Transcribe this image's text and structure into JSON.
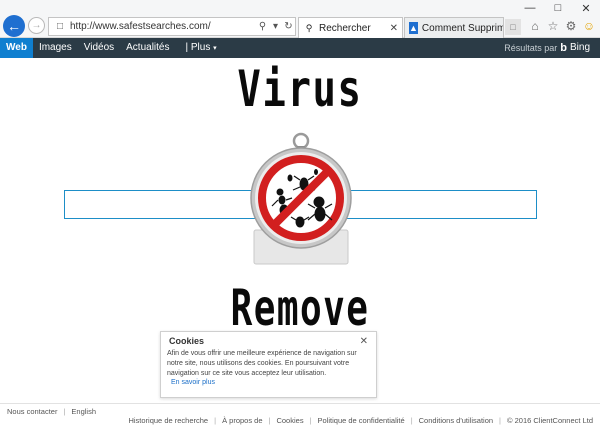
{
  "browser": {
    "address_url": "http://www.safestsearches.com/",
    "tabs": [
      {
        "label": "Rechercher"
      },
      {
        "label": "Comment Supprimer ..."
      }
    ]
  },
  "navbar": {
    "items": [
      "Web",
      "Images",
      "Vidéos",
      "Actualités",
      "| Plus"
    ],
    "brand_prefix": "Résultats par",
    "brand_name": "Bing"
  },
  "main": {
    "title_top": "Virus",
    "title_bottom": "Remove"
  },
  "cookie": {
    "title": "Cookies",
    "body": "Afin de vous offrir une meilleure expérience de navigation sur notre site, nous utilisons des cookies. En poursuivant votre navigation sur ce site vous acceptez leur utilisation.",
    "link": "En savoir plus"
  },
  "footer": {
    "left": [
      "Nous contacter",
      "English"
    ],
    "right": [
      "Historique de recherche",
      "À propos de",
      "Cookies",
      "Politique de confidentialité",
      "Conditions d'utilisation",
      "© 2016 ClientConnect Ltd"
    ]
  },
  "colors": {
    "nav_bg": "#2b3b46",
    "nav_active": "#0f7fd0",
    "search_border": "#1d8ec7",
    "back_button": "#1f6fd0",
    "prohibition_red": "#d21f1f"
  },
  "icons": {
    "back": "back-arrow-icon",
    "forward": "forward-arrow-icon",
    "page": "page-icon",
    "search": "search-icon",
    "refresh": "refresh-icon",
    "home": "home-icon",
    "favorites": "star-icon",
    "settings": "gear-icon",
    "feedback": "smiley-icon",
    "bing": "bing-logo-icon"
  }
}
